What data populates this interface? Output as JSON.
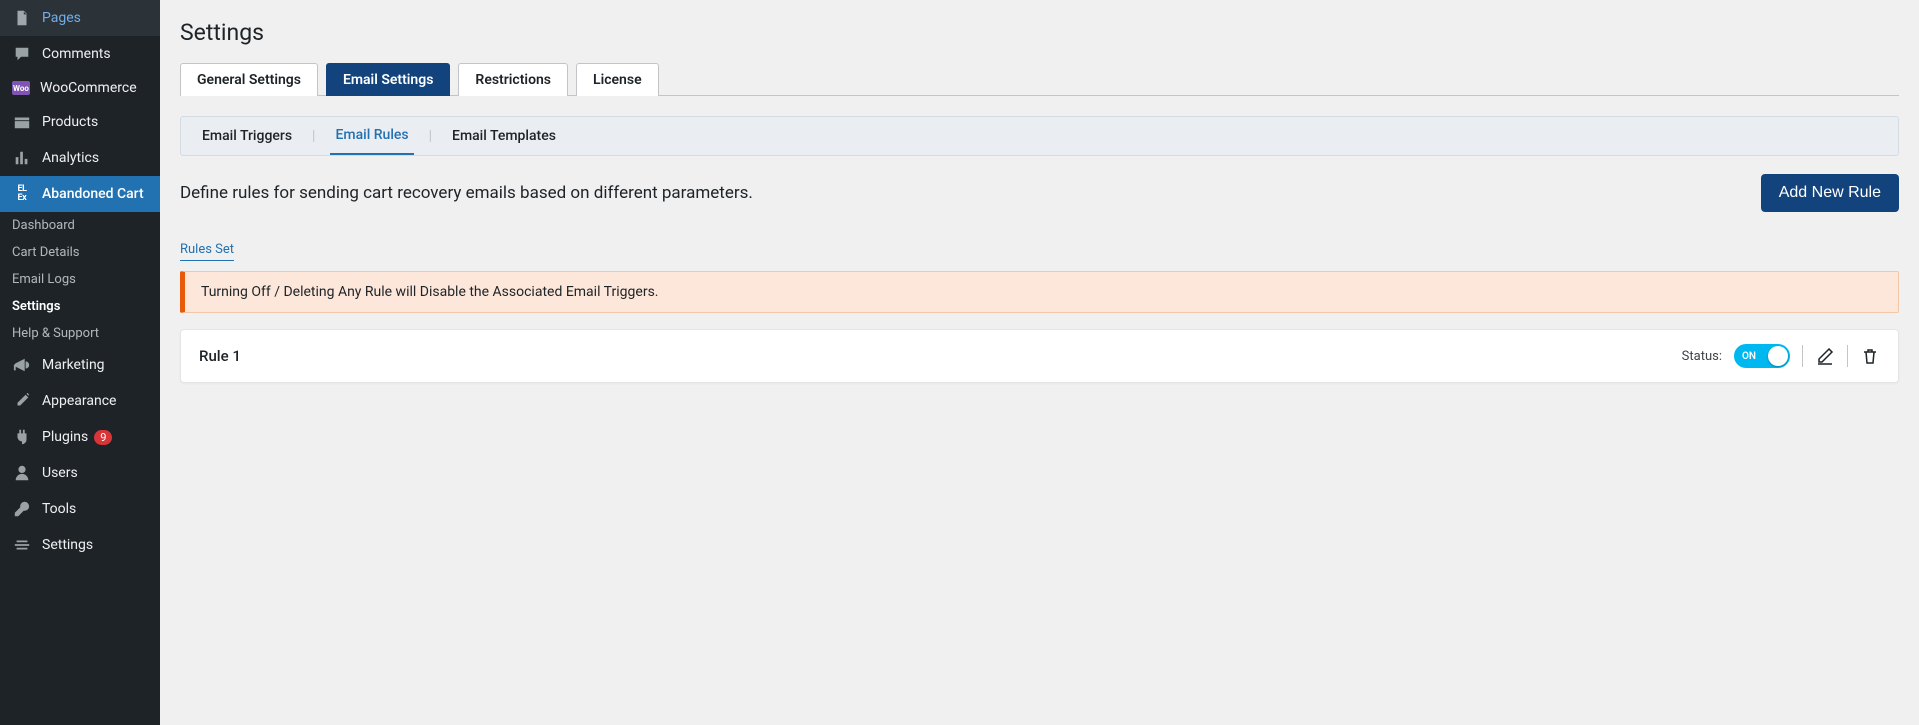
{
  "sidebar": {
    "items": [
      {
        "label": "Pages",
        "icon": "pages"
      },
      {
        "label": "Comments",
        "icon": "comments"
      },
      {
        "label": "WooCommerce",
        "icon": "woo"
      },
      {
        "label": "Products",
        "icon": "products"
      },
      {
        "label": "Analytics",
        "icon": "analytics"
      },
      {
        "label": "Abandoned Cart",
        "icon": "cart",
        "active": true
      },
      {
        "label": "Marketing",
        "icon": "marketing"
      },
      {
        "label": "Appearance",
        "icon": "appearance"
      },
      {
        "label": "Plugins",
        "icon": "plugins",
        "badge": "9"
      },
      {
        "label": "Users",
        "icon": "users"
      },
      {
        "label": "Tools",
        "icon": "tools"
      },
      {
        "label": "Settings",
        "icon": "settings"
      }
    ],
    "subitems": [
      {
        "label": "Dashboard"
      },
      {
        "label": "Cart Details"
      },
      {
        "label": "Email Logs"
      },
      {
        "label": "Settings",
        "active": true
      },
      {
        "label": "Help & Support"
      }
    ]
  },
  "page_title": "Settings",
  "tabs": [
    {
      "label": "General Settings"
    },
    {
      "label": "Email Settings",
      "active": true
    },
    {
      "label": "Restrictions"
    },
    {
      "label": "License"
    }
  ],
  "subtabs": [
    {
      "label": "Email Triggers"
    },
    {
      "label": "Email Rules",
      "active": true
    },
    {
      "label": "Email Templates"
    }
  ],
  "description": "Define rules for sending cart recovery emails based on different parameters.",
  "add_rule_label": "Add New Rule",
  "rules_section_label": "Rules Set",
  "warning_text": "Turning Off / Deleting Any Rule will Disable the Associated Email Triggers.",
  "rules": [
    {
      "name": "Rule 1",
      "status_label": "Status:",
      "toggle_text": "ON"
    }
  ]
}
